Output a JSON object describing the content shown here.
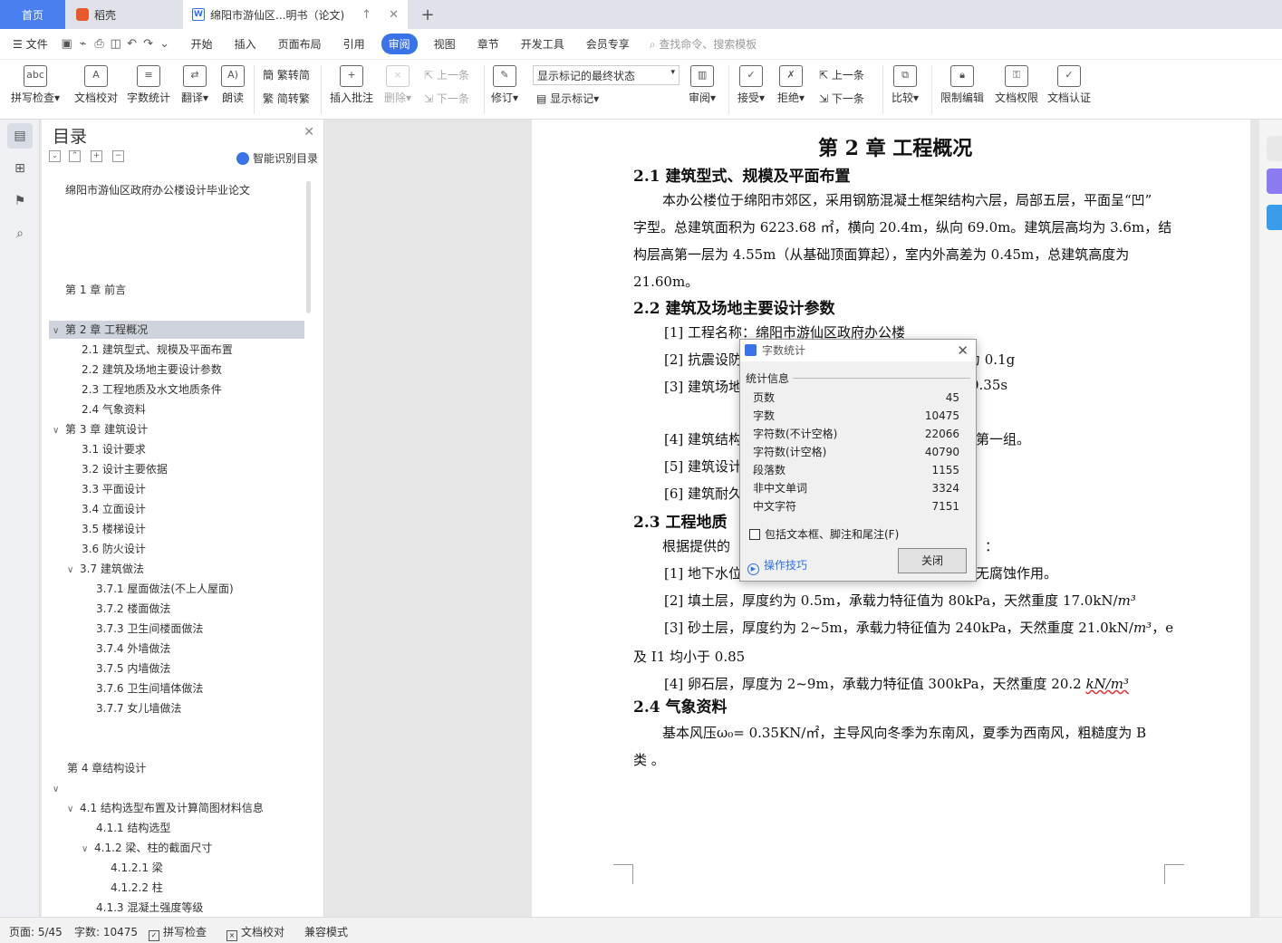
{
  "tabs": {
    "home": "首页",
    "daoke": "稻壳",
    "doc": "绵阳市游仙区...明书（论文)"
  },
  "menu": {
    "file": "文件",
    "items": [
      "开始",
      "插入",
      "页面布局",
      "引用",
      "审阅",
      "视图",
      "章节",
      "开发工具",
      "会员专享"
    ],
    "active_index": 4,
    "search": "查找命令、搜索模板"
  },
  "ribbon": {
    "spell": "拼写检查",
    "doccheck": "文档校对",
    "wordcount": "字数统计",
    "translate": "翻译",
    "read": "朗读",
    "t2s": "繁转简",
    "s2t": "简转繁",
    "insert_comment": "插入批注",
    "delete": "删除",
    "prev": "上一条",
    "next": "下一条",
    "track": "修订",
    "markup_state": "显示标记的最终状态",
    "show_markup": "显示标记",
    "review": "审阅",
    "accept": "接受",
    "reject": "拒绝",
    "prev2": "上一条",
    "next2": "下一条",
    "compare": "比较",
    "restrict": "限制编辑",
    "permission": "文档权限",
    "certify": "文档认证"
  },
  "toc": {
    "title": "目录",
    "smart": "智能识别目录",
    "items": [
      {
        "t": "绵阳市游仙区政府办公楼设计毕业论文",
        "lvl": 0,
        "caret": ""
      },
      {
        "t": "第 1 章  前言",
        "lvl": 0,
        "caret": ""
      },
      {
        "t": "第 2 章  工程概况",
        "lvl": 0,
        "caret": "v",
        "sel": true
      },
      {
        "t": "2.1  建筑型式、规模及平面布置",
        "lvl": 1
      },
      {
        "t": "2.2  建筑及场地主要设计参数",
        "lvl": 1
      },
      {
        "t": "2.3  工程地质及水文地质条件",
        "lvl": 1
      },
      {
        "t": "2.4  气象资料",
        "lvl": 1
      },
      {
        "t": "第 3 章  建筑设计",
        "lvl": 0,
        "caret": "v"
      },
      {
        "t": "3.1  设计要求",
        "lvl": 1
      },
      {
        "t": "3.2  设计主要依据",
        "lvl": 1
      },
      {
        "t": "3.3  平面设计",
        "lvl": 1
      },
      {
        "t": "3.4 立面设计",
        "lvl": 1
      },
      {
        "t": "3.5  楼梯设计",
        "lvl": 1
      },
      {
        "t": "3.6  防火设计",
        "lvl": 1
      },
      {
        "t": "3.7  建筑做法",
        "lvl": 1,
        "caret": "v"
      },
      {
        "t": "3.7.1  屋面做法(不上人屋面)",
        "lvl": 2
      },
      {
        "t": "3.7.2  楼面做法",
        "lvl": 2
      },
      {
        "t": "3.7.3  卫生间楼面做法",
        "lvl": 2
      },
      {
        "t": "3.7.4  外墙做法",
        "lvl": 2
      },
      {
        "t": "3.7.5  内墙做法",
        "lvl": 2
      },
      {
        "t": "3.7.6  卫生间墙体做法",
        "lvl": 2
      },
      {
        "t": "3.7.7  女儿墙做法",
        "lvl": 2
      },
      {
        "t": "第 4 章结构设计",
        "lvl": 0
      },
      {
        "t": "",
        "lvl": 0,
        "caret": "v"
      },
      {
        "t": "4.1  结构选型布置及计算简图材料信息",
        "lvl": 1,
        "caret": "v"
      },
      {
        "t": "4.1.1  结构选型",
        "lvl": 2
      },
      {
        "t": "4.1.2  梁、柱的截面尺寸",
        "lvl": 2,
        "caret": "v"
      },
      {
        "t": "4.1.2.1 梁",
        "lvl": 3
      },
      {
        "t": "4.1.2.2  柱",
        "lvl": 3
      },
      {
        "t": "4.1.3  混凝土强度等级",
        "lvl": 2
      }
    ]
  },
  "doc": {
    "chapter": "第 2 章  工程概况",
    "s21": "2.1  建筑型式、规模及平面布置",
    "p1a": "本办公楼位于绵阳市郊区，采用钢筋混凝土框架结构六层，局部五层，平面呈“凹”",
    "p1b": "字型。总建筑面积为 6223.68 ㎡，横向 20.4m，纵向 69.0m。建筑层高均为 3.6m，结",
    "p1c": "构层高第一层为 4.55m（从基础顶面算起），室内外高差为 0.45m，总建筑高度为",
    "p1d": "21.60m。",
    "s22": "2.2  建筑及场地主要设计参数",
    "l1": "[1]  工程名称：绵阳市游仙区政府办公楼",
    "l2a": "[2]  抗震设防",
    "l2b": "为 0.1g",
    "l3a": "[3]  建筑场地",
    "l3b": "0.35s",
    "l4a": "[4]  建筑结构",
    "l4b": "第一组。",
    "l5": "[5]  建筑设计",
    "l6": "[6]  建筑耐久",
    "s23a": "2.3  工程地质",
    "p3a": "根据提供的",
    "p3b": "：",
    "g1a": "[1]  地下水位",
    "g1b": "无腐蚀作用。",
    "g2": "[2]  填土层，厚度约为 0.5m，承载力特征值为 80kPa，天然重度 17.0kN/",
    "g2u": "m³",
    "g3": "[3]  砂土层，厚度约为 2~5m，承载力特征值为 240kPa，天然重度 21.0kN/",
    "g3u": "m³",
    "g3e": "，e",
    "g3b": "及 I1 均小于 0.85",
    "g4": "[4]  卵石层，厚度为 2~9m，承载力特征值 300kPa，天然重度 20.2 ",
    "g4u": "kN/m³",
    "s24": "2.4  气象资料",
    "p4a": "基本风压ω₀= 0.35KN/㎡，主导风向冬季为东南风，夏季为西南风，粗糙度为 B",
    "p4b": "类 。"
  },
  "dialog": {
    "title": "字数统计",
    "group": "统计信息",
    "rows": [
      {
        "k": "页数",
        "v": "45"
      },
      {
        "k": "字数",
        "v": "10475"
      },
      {
        "k": "字符数(不计空格)",
        "v": "22066"
      },
      {
        "k": "字符数(计空格)",
        "v": "40790"
      },
      {
        "k": "段落数",
        "v": "1155"
      },
      {
        "k": "非中文单词",
        "v": "3324"
      },
      {
        "k": "中文字符",
        "v": "7151"
      }
    ],
    "checkbox": "包括文本框、脚注和尾注(F)",
    "tips": "操作技巧",
    "close": "关闭"
  },
  "status": {
    "page": "页面: 5/45",
    "words": "字数: 10475",
    "spell": "拼写检查",
    "doccheck": "文档校对",
    "compat": "兼容模式"
  }
}
